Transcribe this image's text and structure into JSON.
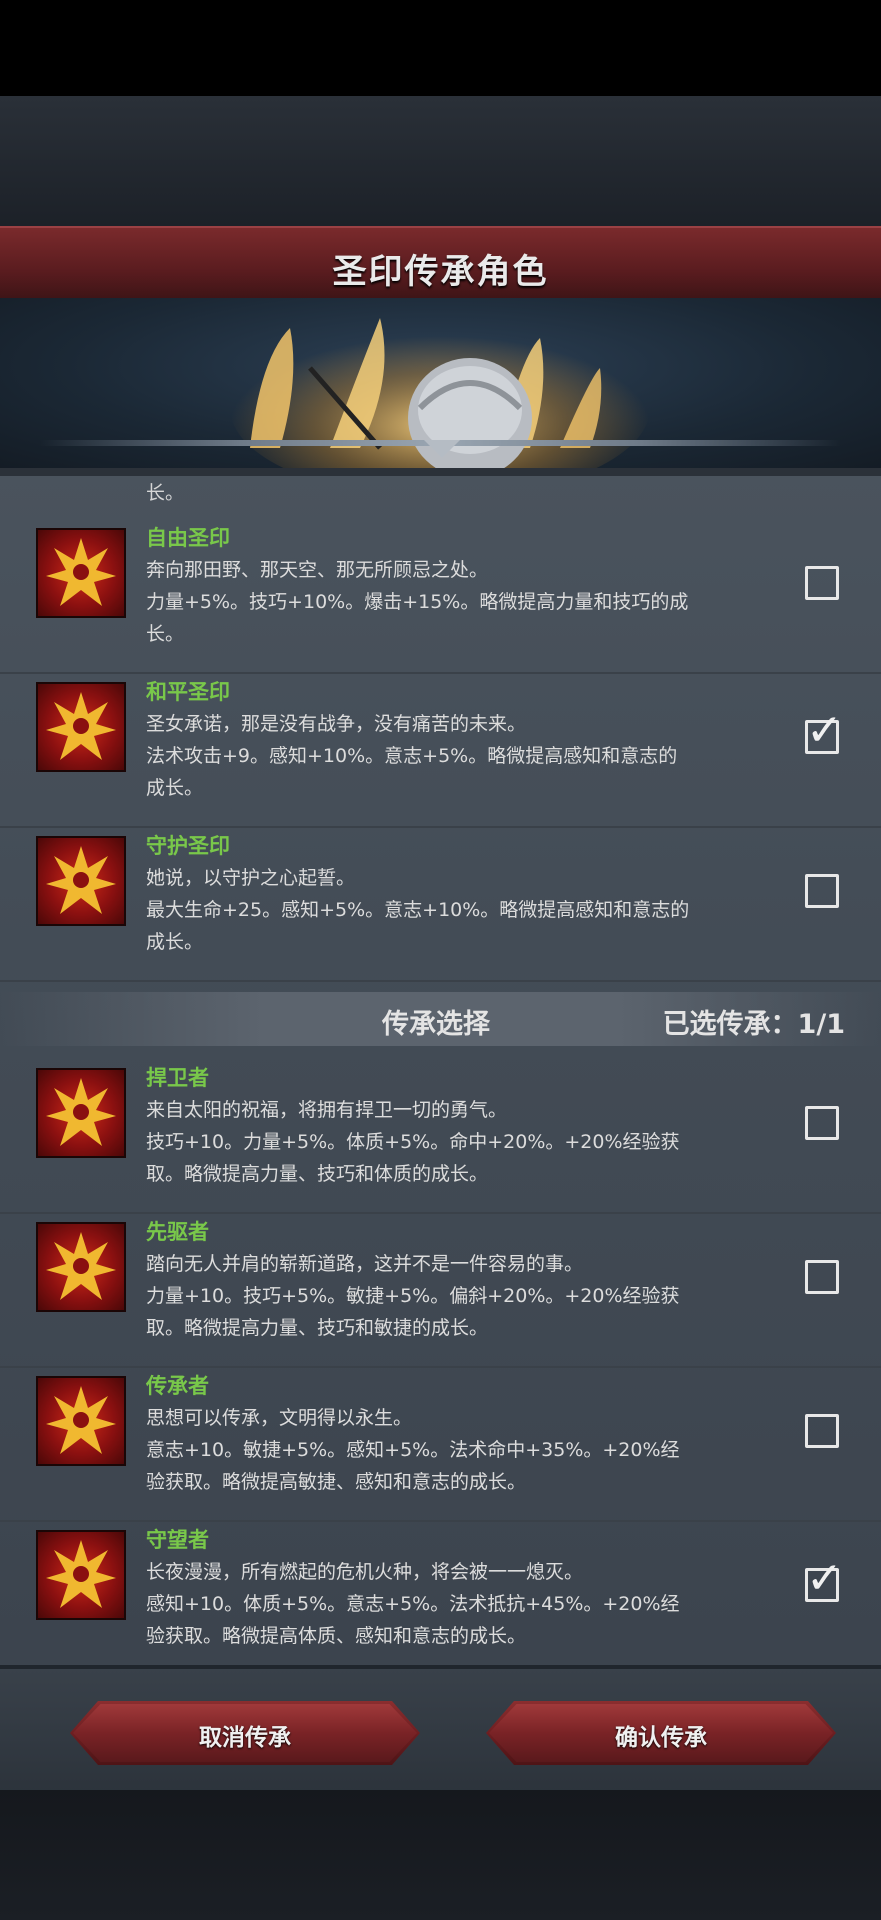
{
  "title": "圣印传承角色",
  "list_cutoff_text": "长。",
  "seals": [
    {
      "name": "自由圣印",
      "line1": "奔向那田野、那天空、那无所顾忌之处。",
      "line2": "力量+5%。技巧+10%。爆击+15%。略微提高力量和技巧的成",
      "line3": "长。",
      "checked": false
    },
    {
      "name": "和平圣印",
      "line1": "圣女承诺，那是没有战争，没有痛苦的未来。",
      "line2": "法术攻击+9。感知+10%。意志+5%。略微提高感知和意志的",
      "line3": "成长。",
      "checked": true
    },
    {
      "name": "守护圣印",
      "line1": "她说，以守护之心起誓。",
      "line2": "最大生命+25。感知+5%。意志+10%。略微提高感知和意志的",
      "line3": "成长。",
      "checked": false
    }
  ],
  "section": {
    "label": "传承选择",
    "count": "已选传承：1/1"
  },
  "legacies": [
    {
      "name": "捍卫者",
      "line1": "来自太阳的祝福，将拥有捍卫一切的勇气。",
      "line2": "技巧+10。力量+5%。体质+5%。命中+20%。+20%经验获",
      "line3": "取。略微提高力量、技巧和体质的成长。",
      "checked": false
    },
    {
      "name": "先驱者",
      "line1": "踏向无人并肩的崭新道路，这并不是一件容易的事。",
      "line2": "力量+10。技巧+5%。敏捷+5%。偏斜+20%。+20%经验获",
      "line3": "取。略微提高力量、技巧和敏捷的成长。",
      "checked": false
    },
    {
      "name": "传承者",
      "line1": "思想可以传承，文明得以永生。",
      "line2": "意志+10。敏捷+5%。感知+5%。法术命中+35%。+20%经",
      "line3": "验获取。略微提高敏捷、感知和意志的成长。",
      "checked": false
    },
    {
      "name": "守望者",
      "line1": "长夜漫漫，所有燃起的危机火种，将会被一一熄灭。",
      "line2": "感知+10。体质+5%。意志+5%。法术抵抗+45%。+20%经",
      "line3": "验获取。略微提高体质、感知和意志的成长。",
      "checked": true
    }
  ],
  "buttons": {
    "cancel": "取消传承",
    "confirm": "确认传承"
  }
}
